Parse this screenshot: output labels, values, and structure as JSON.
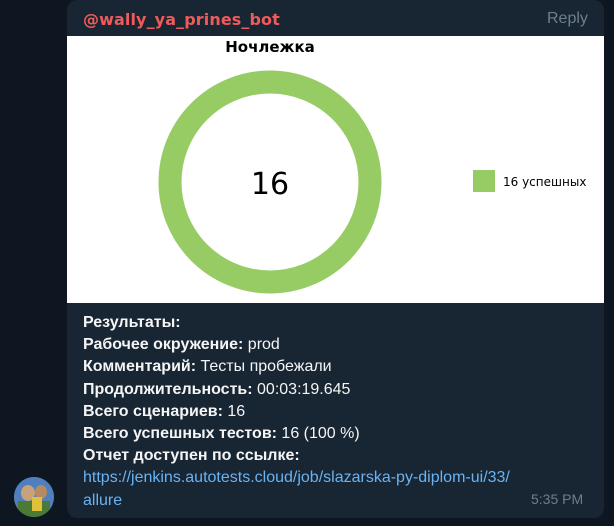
{
  "message": {
    "sender": "@wally_ya_prines_bot",
    "reply_label": "Reply",
    "time": "5:35 PM"
  },
  "chart_data": {
    "type": "pie",
    "title": "Ночлежка",
    "center_text": "16",
    "slices": [
      {
        "name": "16 успешных",
        "value": 16,
        "color": "#97cc64"
      }
    ],
    "legend": {
      "placement": "right",
      "entries": [
        "16 успешных"
      ]
    }
  },
  "results": {
    "heading": "Результаты:",
    "env_label": "Рабочее окружение:",
    "env_value": " prod",
    "comment_label": "Комментарий:",
    "comment_value": " Тесты пробежали",
    "duration_label": "Продолжительность:",
    "duration_value": " 00:03:19.645",
    "scenarios_label": "Всего сценариев:",
    "scenarios_value": " 16",
    "passed_label": "Всего успешных тестов:",
    "passed_value": " 16 (100 %)",
    "report_label": "Отчет доступен по ссылке:",
    "report_link": "https://jenkins.autotests.cloud/job/slazarska-py-diplom-ui/33/allure"
  },
  "colors": {
    "background": "#0e1621",
    "bubble": "#182533",
    "sender": "#ef5b5b",
    "link": "#6ab3f3",
    "muted": "#6d7f8f"
  }
}
